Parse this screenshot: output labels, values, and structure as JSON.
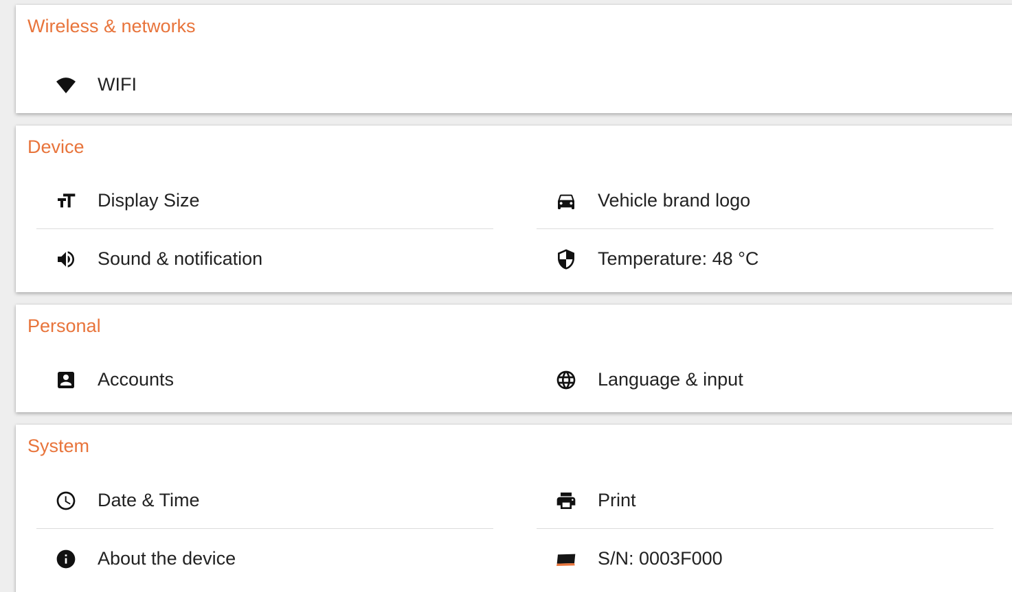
{
  "colors": {
    "accent": "#e8743b",
    "text": "#222222",
    "divider": "#dcdcdc",
    "background": "#eeeeee"
  },
  "sections": {
    "wireless": {
      "title": "Wireless & networks",
      "items": {
        "wifi": {
          "label": "WIFI",
          "icon": "wifi-icon"
        }
      }
    },
    "device": {
      "title": "Device",
      "items": {
        "display_size": {
          "label": "Display Size",
          "icon": "text-size-icon"
        },
        "vehicle_logo": {
          "label": "Vehicle brand logo",
          "icon": "car-icon"
        },
        "sound": {
          "label": "Sound & notification",
          "icon": "speaker-icon"
        },
        "temperature": {
          "label": "Temperature: 48 °C",
          "icon": "shield-icon"
        }
      }
    },
    "personal": {
      "title": "Personal",
      "items": {
        "accounts": {
          "label": "Accounts",
          "icon": "account-box-icon"
        },
        "language": {
          "label": "Language & input",
          "icon": "globe-icon"
        }
      }
    },
    "system": {
      "title": "System",
      "items": {
        "datetime": {
          "label": "Date & Time",
          "icon": "clock-icon"
        },
        "print": {
          "label": "Print",
          "icon": "printer-icon"
        },
        "about": {
          "label": "About the device",
          "icon": "info-icon"
        },
        "serial": {
          "label": "S/N: 0003F000",
          "icon": "device-icon"
        }
      }
    }
  }
}
